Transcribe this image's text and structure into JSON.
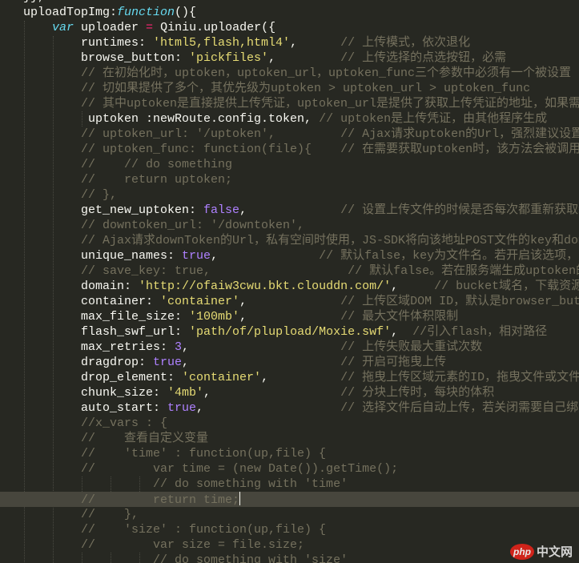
{
  "colors": {
    "background": "#272822",
    "current_line": "#47463d",
    "comment": "#75715e",
    "string": "#e6db74",
    "keyword": "#66d9ef",
    "operator": "#f92672",
    "constant": "#ae81ff",
    "text": "#f8f8f2"
  },
  "current_line_index": 33,
  "watermark": {
    "logo": "php",
    "text": "中文网"
  },
  "lines": [
    [
      {
        "t": "}},",
        "c": "p"
      }
    ],
    [
      {
        "t": "uploadTopImg:",
        "c": "p"
      },
      {
        "t": "function",
        "c": "k"
      },
      {
        "t": "(){",
        "c": "p"
      }
    ],
    [
      {
        "t": "    ",
        "c": "p"
      },
      {
        "t": "var",
        "c": "k"
      },
      {
        "t": " uploader ",
        "c": "p"
      },
      {
        "t": "=",
        "c": "o"
      },
      {
        "t": " Qiniu.uploader({",
        "c": "p"
      }
    ],
    [
      {
        "t": "        runtimes: ",
        "c": "p"
      },
      {
        "t": "'html5,flash,html4'",
        "c": "s"
      },
      {
        "t": ",      ",
        "c": "p"
      },
      {
        "t": "// 上传模式，依次退化",
        "c": "c"
      }
    ],
    [
      {
        "t": "        browse_button: ",
        "c": "p"
      },
      {
        "t": "'pickfiles'",
        "c": "s"
      },
      {
        "t": ",         ",
        "c": "p"
      },
      {
        "t": "// 上传选择的点选按钮，必需",
        "c": "c"
      }
    ],
    [
      {
        "t": "        // 在初始化时，uptoken，uptoken_url，uptoken_func三个参数中必须有一个被设置",
        "c": "c"
      }
    ],
    [
      {
        "t": "        // 切如果提供了多个，其优先级为uptoken > uptoken_url > uptoken_func",
        "c": "c"
      }
    ],
    [
      {
        "t": "        // 其中uptoken是直接提供上传凭证，uptoken_url是提供了获取上传凭证的地址，如果需要定制获取upt",
        "c": "c"
      }
    ],
    [
      {
        "t": "         uptoken :newRoute.config.token, ",
        "c": "p"
      },
      {
        "t": "// uptoken是上传凭证，由其他程序生成",
        "c": "c"
      }
    ],
    [
      {
        "t": "        // uptoken_url: '/uptoken',         // Ajax请求uptoken的Url，强烈建议设置（服",
        "c": "c"
      }
    ],
    [
      {
        "t": "        // uptoken_func: function(file){    // 在需要获取uptoken时，该方法会被调用",
        "c": "c"
      }
    ],
    [
      {
        "t": "        //    // do something",
        "c": "c"
      }
    ],
    [
      {
        "t": "        //    return uptoken;",
        "c": "c"
      }
    ],
    [
      {
        "t": "        // },",
        "c": "c"
      }
    ],
    [
      {
        "t": "        get_new_uptoken: ",
        "c": "p"
      },
      {
        "t": "false",
        "c": "n"
      },
      {
        "t": ",             ",
        "c": "p"
      },
      {
        "t": "// 设置上传文件的时候是否每次都重新获取新的uptok",
        "c": "c"
      }
    ],
    [
      {
        "t": "        // downtoken_url: '/downtoken',",
        "c": "c"
      }
    ],
    [
      {
        "t": "        // Ajax请求downToken的Url，私有空间时使用，JS-SDK将向该地址POST文件的key和domain，服务",
        "c": "c"
      }
    ],
    [
      {
        "t": "        unique_names: ",
        "c": "p"
      },
      {
        "t": "true",
        "c": "n"
      },
      {
        "t": ",              ",
        "c": "p"
      },
      {
        "t": "// 默认false，key为文件名。若开启该选项，JS-SDK",
        "c": "c"
      }
    ],
    [
      {
        "t": "        // save_key: true,                   // 默认false。若在服务端生成uptoken的上传策",
        "c": "c"
      }
    ],
    [
      {
        "t": "        domain: ",
        "c": "p"
      },
      {
        "t": "'http://ofaiw3cwu.bkt.clouddn.com/'",
        "c": "s"
      },
      {
        "t": ",     ",
        "c": "p"
      },
      {
        "t": "// bucket域名，下载资源时用",
        "c": "c"
      }
    ],
    [
      {
        "t": "        container: ",
        "c": "p"
      },
      {
        "t": "'container'",
        "c": "s"
      },
      {
        "t": ",             ",
        "c": "p"
      },
      {
        "t": "// 上传区域DOM ID，默认是browser_button",
        "c": "c"
      }
    ],
    [
      {
        "t": "        max_file_size: ",
        "c": "p"
      },
      {
        "t": "'100mb'",
        "c": "s"
      },
      {
        "t": ",             ",
        "c": "p"
      },
      {
        "t": "// 最大文件体积限制",
        "c": "c"
      }
    ],
    [
      {
        "t": "        flash_swf_url: ",
        "c": "p"
      },
      {
        "t": "'path/of/plupload/Moxie.swf'",
        "c": "s"
      },
      {
        "t": ",  ",
        "c": "p"
      },
      {
        "t": "//引入flash，相对路径",
        "c": "c"
      }
    ],
    [
      {
        "t": "        max_retries: ",
        "c": "p"
      },
      {
        "t": "3",
        "c": "n"
      },
      {
        "t": ",                     ",
        "c": "p"
      },
      {
        "t": "// 上传失败最大重试次数",
        "c": "c"
      }
    ],
    [
      {
        "t": "        dragdrop: ",
        "c": "p"
      },
      {
        "t": "true",
        "c": "n"
      },
      {
        "t": ",                     ",
        "c": "p"
      },
      {
        "t": "// 开启可拖曳上传",
        "c": "c"
      }
    ],
    [
      {
        "t": "        drop_element: ",
        "c": "p"
      },
      {
        "t": "'container'",
        "c": "s"
      },
      {
        "t": ",          ",
        "c": "p"
      },
      {
        "t": "// 拖曳上传区域元素的ID，拖曳文件或文件夹后可触发",
        "c": "c"
      }
    ],
    [
      {
        "t": "        chunk_size: ",
        "c": "p"
      },
      {
        "t": "'4mb'",
        "c": "s"
      },
      {
        "t": ",                  ",
        "c": "p"
      },
      {
        "t": "// 分块上传时，每块的体积",
        "c": "c"
      }
    ],
    [
      {
        "t": "        auto_start: ",
        "c": "p"
      },
      {
        "t": "true",
        "c": "n"
      },
      {
        "t": ",                   ",
        "c": "p"
      },
      {
        "t": "// 选择文件后自动上传，若关闭需要自己绑定事件触发",
        "c": "c"
      }
    ],
    [
      {
        "t": "        //x_vars : {",
        "c": "c"
      }
    ],
    [
      {
        "t": "        //    查看自定义变量",
        "c": "c"
      }
    ],
    [
      {
        "t": "        //    'time' : function(up,file) {",
        "c": "c"
      }
    ],
    [
      {
        "t": "        //        var time = (new Date()).getTime();",
        "c": "c"
      }
    ],
    [
      {
        "t": "                  // do something with 'time'",
        "c": "c"
      }
    ],
    [
      {
        "t": "        //        return time;",
        "c": "c"
      }
    ],
    [
      {
        "t": "        //    },",
        "c": "c"
      }
    ],
    [
      {
        "t": "        //    'size' : function(up,file) {",
        "c": "c"
      }
    ],
    [
      {
        "t": "        //        var size = file.size;",
        "c": "c"
      }
    ],
    [
      {
        "t": "                  // do something with 'size'",
        "c": "c"
      }
    ]
  ]
}
